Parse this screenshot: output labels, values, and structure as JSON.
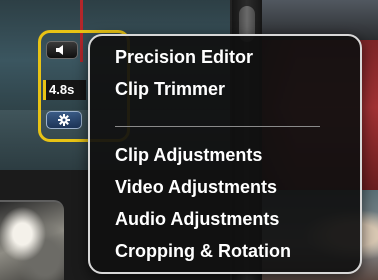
{
  "clip_controls": {
    "volume_icon": "speaker-icon",
    "duration": "4.8s",
    "settings_icon": "gear-icon",
    "highlight_color": "#e8c315"
  },
  "menu": {
    "group1": [
      {
        "label": "Precision Editor"
      },
      {
        "label": "Clip Trimmer"
      }
    ],
    "group2": [
      {
        "label": "Clip Adjustments"
      },
      {
        "label": "Video Adjustments"
      },
      {
        "label": "Audio Adjustments"
      },
      {
        "label": "Cropping & Rotation"
      }
    ]
  }
}
